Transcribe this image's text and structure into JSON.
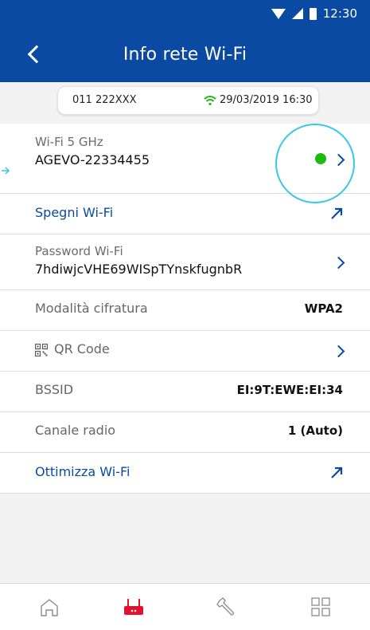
{
  "statusbar": {
    "time": "12:30"
  },
  "header": {
    "title": "Info rete Wi-Fi"
  },
  "info_card": {
    "number": "011 222XXX",
    "date": "29/03/2019 16:30"
  },
  "rows": {
    "wifi5": {
      "label": "Wi-Fi 5 GHz",
      "value": "AGEVO-22334455",
      "status_color": "#22b814"
    },
    "turn_off": {
      "label": "Spegni Wi-Fi"
    },
    "password": {
      "label": "Password Wi-Fi",
      "value": "7hdiwjcVHE69WISpTYnskfugnbR"
    },
    "encryption": {
      "label": "Modalità cifratura",
      "value": "WPA2"
    },
    "qr": {
      "label": "QR Code"
    },
    "bssid": {
      "label": "BSSID",
      "value": "EI:9T:EWE:EI:34"
    },
    "channel": {
      "label": "Canale radio",
      "value": "1 (Auto)"
    },
    "optimize": {
      "label": "Ottimizza Wi-Fi"
    }
  },
  "bottom_nav": {
    "items": [
      "home-icon",
      "router-icon",
      "wrench-icon",
      "grid-icon"
    ],
    "active_color": "#e0132e",
    "inactive_color": "#8a8a8a"
  },
  "colors": {
    "brand_blue": "#0b4aa2",
    "highlight": "#39c6e8"
  }
}
